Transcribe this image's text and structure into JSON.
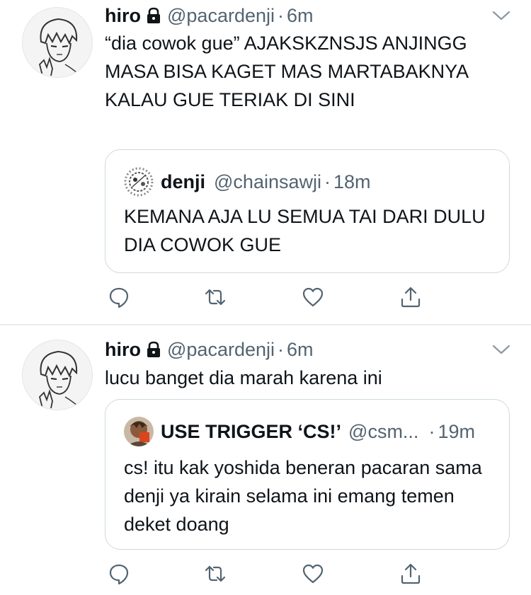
{
  "colors": {
    "text": "#0f1419",
    "secondary": "#536471",
    "border": "#cfd9de",
    "separator": "#e6ecf0"
  },
  "tweets": [
    {
      "author": {
        "name": "hiro",
        "handle": "@pacardenji",
        "protected_icon": "lock-icon"
      },
      "separator": "·",
      "time": "6m",
      "text": "“dia cowok gue” AJAKSKZNSJS ANJINGG MASA BISA KAGET MAS MARTABAKNYA KALAU GUE TERIAK DI SINI",
      "quote": {
        "author": {
          "name": "denji",
          "handle": "@chainsawji"
        },
        "separator": "·",
        "time": "18m",
        "text": "KEMANA AJA LU SEMUA TAI DARI DULU DIA COWOK GUE"
      },
      "actions": [
        "reply-icon",
        "retweet-icon",
        "like-icon",
        "share-icon"
      ]
    },
    {
      "author": {
        "name": "hiro",
        "handle": "@pacardenji",
        "protected_icon": "lock-icon"
      },
      "separator": "·",
      "time": "6m",
      "text": "lucu banget dia marah karena ini",
      "quote": {
        "author": {
          "name": "USE TRIGGER ‘CS!’",
          "handle": "@csm..."
        },
        "separator": "·",
        "time": "19m",
        "text": "cs! itu kak yoshida beneran pacaran sama denji ya kirain selama ini emang temen deket doang"
      },
      "actions": [
        "reply-icon",
        "retweet-icon",
        "like-icon",
        "share-icon"
      ]
    }
  ]
}
